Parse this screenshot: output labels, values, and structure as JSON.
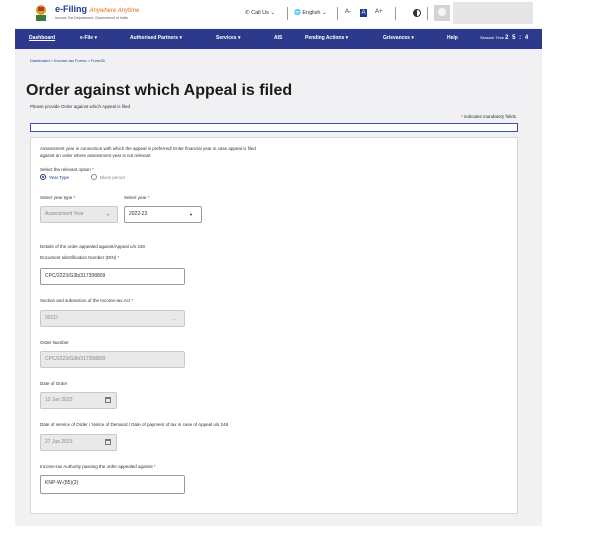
{
  "header": {
    "logo_title": "e-Filing",
    "logo_tagline": "Anywhere Anytime",
    "logo_sub": "Income Tax Department, Government of India",
    "call_us": "Call Us",
    "language": "English",
    "font_sizes": [
      "A-",
      "A",
      "A+"
    ]
  },
  "nav": {
    "items": [
      "Dashboard",
      "e-File",
      "Authorised Partners",
      "Services",
      "AIS",
      "Pending Actions",
      "Grievances",
      "Help"
    ],
    "session_label": "Session Time",
    "session_value": "2 5 : 4"
  },
  "breadcrumb": "Dashboard  >  Income-tax Forms  >  Form35",
  "page": {
    "title": "Order against which Appeal is filed",
    "subtitle": "Please provide Order against which Appeal is filed",
    "mandatory_note": "indicates mandatory fields"
  },
  "form": {
    "ay_note_line1": "Assessment year in connection with which the appeal is preferred/ Enter financial year in case appeal is filed",
    "ay_note_line2": "against an order where assessment year is not relevant",
    "option_label": "Select the relevant option",
    "option_year_type": "Year Type",
    "option_block_period": "Block period",
    "year_type_label": "Select year type",
    "year_type_value": "Assessment Year",
    "year_label": "Select year",
    "year_value": "2022-23",
    "details_heading": "Details of the order appealed against/Appeal u/s 248",
    "din_label": "Document Identification Number (DIN)",
    "din_value": "CPC/2223/G3b/317398809",
    "section_label": "Section and subsection of the Income-tax Act",
    "section_value": "92CD",
    "order_number_label": "Order Number",
    "order_number_value": "CPC/2223/G3b/317398809",
    "date_of_order_label": "Date of Order",
    "date_of_order_value": "13 Jun 2023",
    "date_of_service_label": "Date of service of Order / Notice of Demand / Date of payment of tax in case of Appeal u/s 248",
    "date_of_service_value": "27 Jun 2023",
    "authority_label": "Income-tax Authority passing the order appealed against",
    "authority_value": "KNP-W-(85)(3)"
  },
  "colors": {
    "nav_bg": "#2d3a8c",
    "brand_blue": "#1e3a8a",
    "required_red": "#d32f2f"
  }
}
